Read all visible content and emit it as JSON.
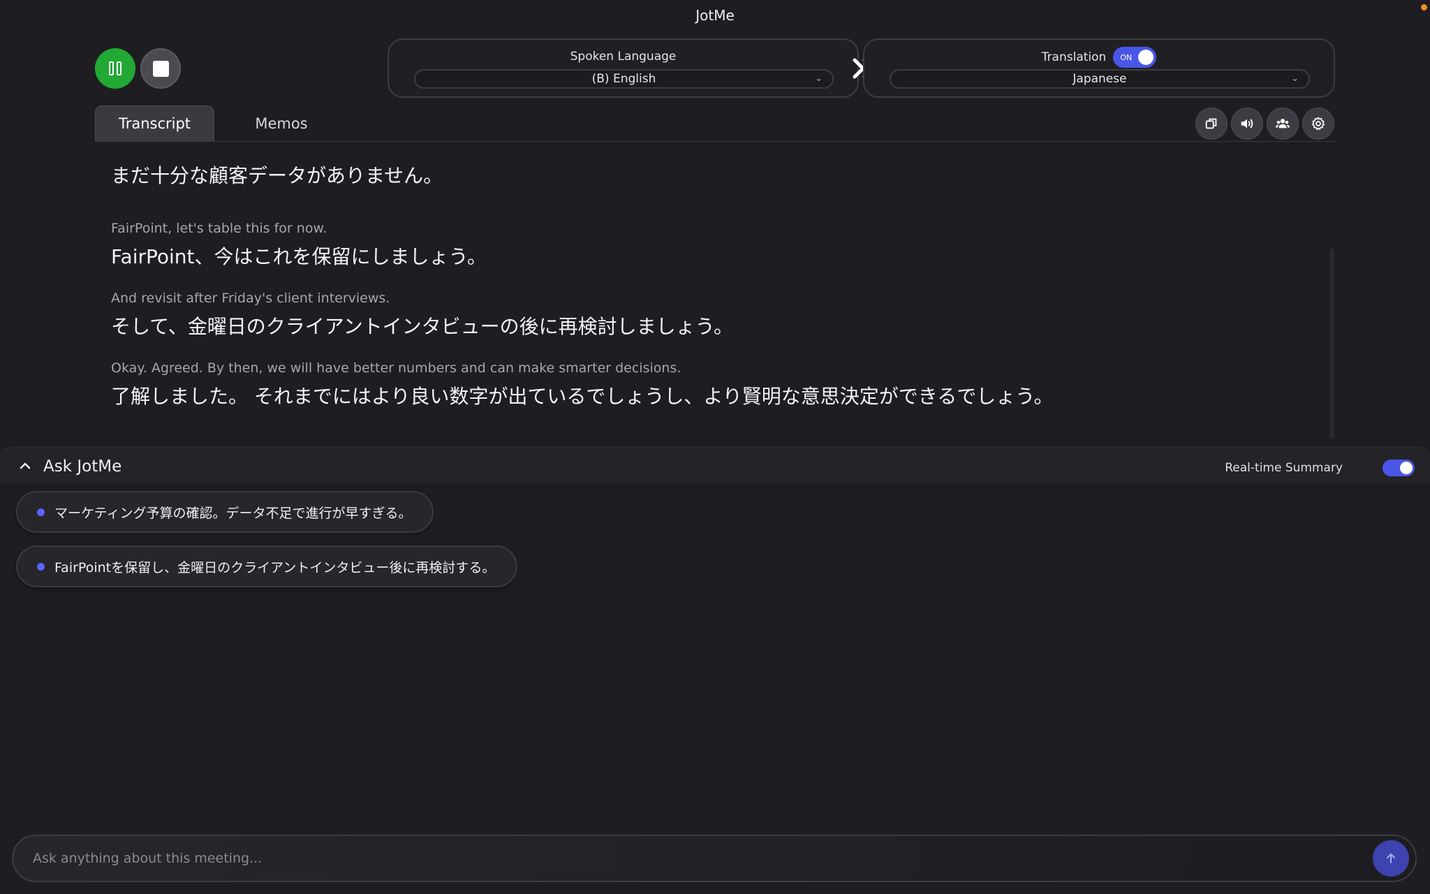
{
  "app": {
    "title": "JotMe"
  },
  "controls": {
    "pause_icon": "pause-icon",
    "stop_icon": "stop-icon"
  },
  "spoken_language": {
    "label": "Spoken Language",
    "selected": "(B) English"
  },
  "translation": {
    "label": "Translation",
    "toggle_text": "ON",
    "enabled": true,
    "selected": "Japanese"
  },
  "tabs": [
    {
      "label": "Transcript",
      "active": true
    },
    {
      "label": "Memos",
      "active": false
    }
  ],
  "toolbar": {
    "icons": [
      "copy-window-icon",
      "speaker-icon",
      "participants-icon",
      "gear-icon"
    ]
  },
  "transcript": {
    "first_line": "まだ十分な顧客データがありません。",
    "segments": [
      {
        "source": "FairPoint, let's table this for now.",
        "translation": "FairPoint、今はこれを保留にしましょう。"
      },
      {
        "source": "And revisit after Friday's client interviews.",
        "translation": "そして、金曜日のクライアントインタビューの後に再検討しましょう。"
      },
      {
        "source": "Okay. Agreed. By then, we will have better numbers and can make smarter decisions.",
        "translation": "了解しました。 それまでにはより良い数字が出ているでしょうし、より賢明な意思決定ができるでしょう。"
      }
    ]
  },
  "ask": {
    "title": "Ask JotMe",
    "realtime_summary_label": "Real-time Summary",
    "realtime_summary_enabled": true,
    "summary_items": [
      "マーケティング予算の確認。データ不足で進行が早すぎる。",
      "FairPointを保留し、金曜日のクライアントインタビュー後に再検討する。"
    ],
    "input_placeholder": "Ask anything about this meeting..."
  },
  "colors": {
    "accent": "#4a56e6",
    "record_green": "#22a834",
    "background": "#1e1e22"
  }
}
